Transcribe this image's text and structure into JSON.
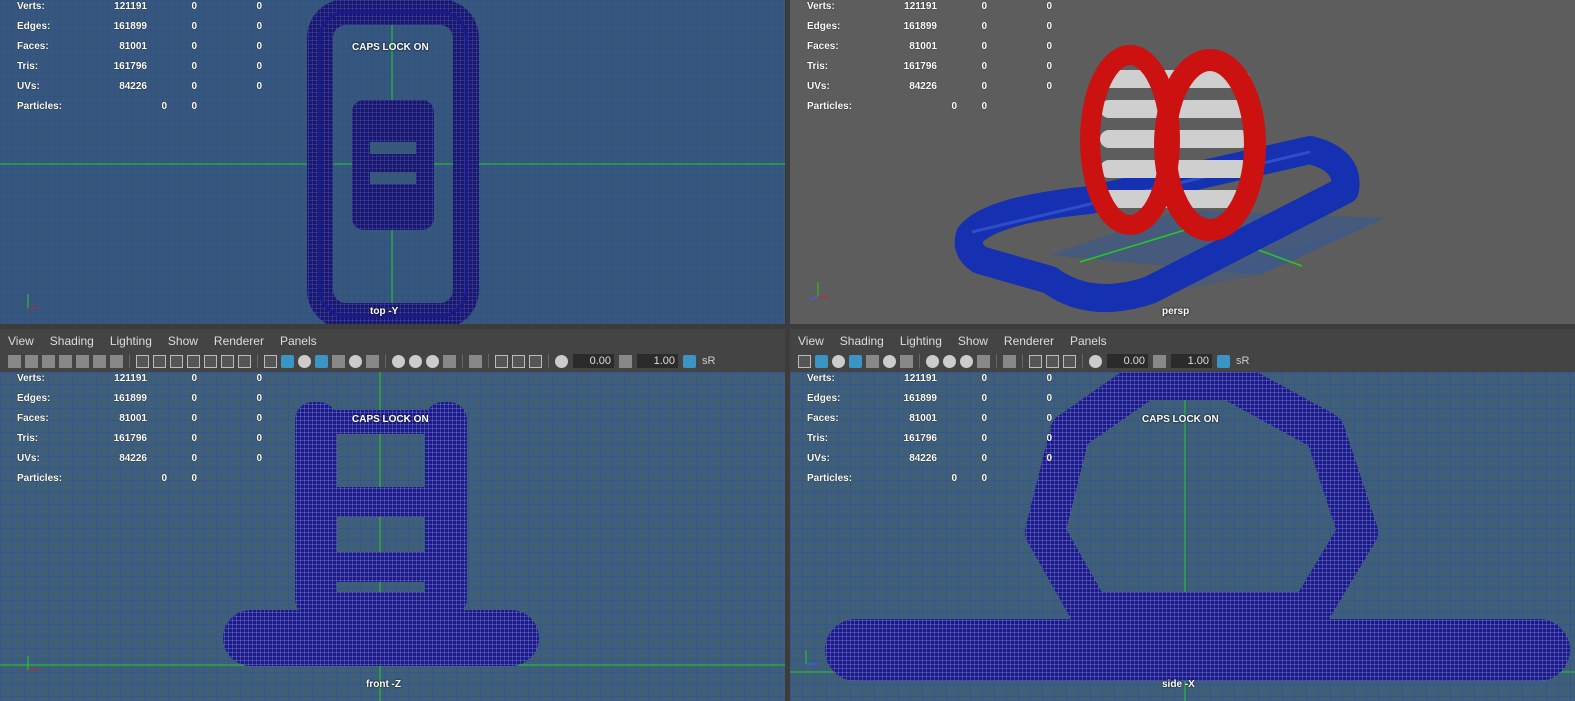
{
  "stats": {
    "labels": [
      "Verts:",
      "Edges:",
      "Faces:",
      "Tris:",
      "UVs:",
      "Particles:"
    ],
    "rows": [
      {
        "label": "Verts:",
        "v1": "121191",
        "v2": "0",
        "v3": "0"
      },
      {
        "label": "Edges:",
        "v1": "161899",
        "v2": "0",
        "v3": "0"
      },
      {
        "label": "Faces:",
        "v1": "81001",
        "v2": "0",
        "v3": "0"
      },
      {
        "label": "Tris:",
        "v1": "161796",
        "v2": "0",
        "v3": "0"
      },
      {
        "label": "UVs:",
        "v1": "84226",
        "v2": "0",
        "v3": "0"
      }
    ],
    "particles": {
      "label": "Particles:",
      "v1": "0",
      "v2": "0"
    }
  },
  "caps_lock": "CAPS LOCK ON",
  "viewports": {
    "top": {
      "camera": "top -Y"
    },
    "persp": {
      "camera": "persp"
    },
    "front": {
      "camera": "front -Z"
    },
    "side": {
      "camera": "side -X"
    }
  },
  "panel_menu": [
    "View",
    "Shading",
    "Lighting",
    "Show",
    "Renderer",
    "Panels"
  ],
  "toolbar": {
    "exposure": "0.00",
    "gamma": "1.00",
    "sr_label": "sR"
  },
  "axis_labels": {
    "x": "x",
    "y": "y",
    "z": "z"
  },
  "colors": {
    "ortho_bg": "#37587a",
    "persp_bg": "#5d5d5d",
    "wire": "#1a1a8a",
    "red": "#cc1111",
    "blue": "#1530b0",
    "green_axis": "#22cc22"
  }
}
